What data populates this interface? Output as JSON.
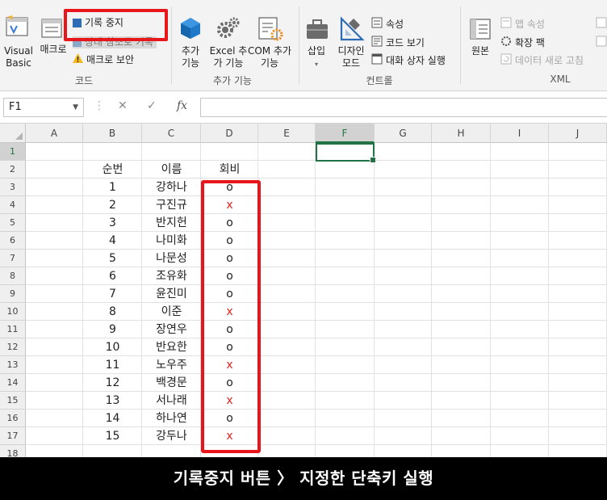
{
  "ribbon": {
    "code_group": {
      "visual_basic": "Visual Basic",
      "macro": "매크로",
      "record_stop": "기록 중지",
      "relative_ref": "상대 참조로 기록",
      "macro_security": "매크로 보안",
      "label": "코드"
    },
    "addins_group": {
      "addins": "추가 기능",
      "excel_addins": "Excel 추가 기능",
      "com_addins": "COM 추가 기능",
      "label": "추가 기능"
    },
    "controls_group": {
      "insert": "삽입",
      "design_mode": "디자인 모드",
      "properties": "속성",
      "view_code": "코드 보기",
      "run_dialog": "대화 상자 실행",
      "label": "컨트롤"
    },
    "xml_group": {
      "source": "원본",
      "map_properties": "맵 속성",
      "expansion_packs": "확장 팩",
      "refresh_data": "데이터 새로 고침",
      "label": "XML"
    }
  },
  "formula_bar": {
    "name_box": "F1",
    "formula": ""
  },
  "sheet": {
    "columns": [
      "A",
      "B",
      "C",
      "D",
      "E",
      "F",
      "G",
      "H",
      "I",
      "J"
    ],
    "selected_column": "F",
    "selected_row": "1",
    "rows": [
      "1",
      "2",
      "3",
      "4",
      "5",
      "6",
      "7",
      "8",
      "9",
      "10",
      "11",
      "12",
      "13",
      "14",
      "15",
      "16",
      "17",
      "18"
    ],
    "headers": {
      "b": "순번",
      "c": "이름",
      "d": "회비"
    },
    "records": [
      {
        "no": "1",
        "name": "강하나",
        "fee": "o"
      },
      {
        "no": "2",
        "name": "구진규",
        "fee": "x"
      },
      {
        "no": "3",
        "name": "반지헌",
        "fee": "o"
      },
      {
        "no": "4",
        "name": "나미화",
        "fee": "o"
      },
      {
        "no": "5",
        "name": "나문성",
        "fee": "o"
      },
      {
        "no": "6",
        "name": "조유화",
        "fee": "o"
      },
      {
        "no": "7",
        "name": "윤진미",
        "fee": "o"
      },
      {
        "no": "8",
        "name": "이준",
        "fee": "x"
      },
      {
        "no": "9",
        "name": "장연우",
        "fee": "o"
      },
      {
        "no": "10",
        "name": "반요한",
        "fee": "o"
      },
      {
        "no": "11",
        "name": "노우주",
        "fee": "x"
      },
      {
        "no": "12",
        "name": "백경문",
        "fee": "o"
      },
      {
        "no": "13",
        "name": "서나래",
        "fee": "x"
      },
      {
        "no": "14",
        "name": "하나연",
        "fee": "o"
      },
      {
        "no": "15",
        "name": "강두나",
        "fee": "x"
      }
    ]
  },
  "caption": "기록중지 버튼 〉 지정한 단축키 실행",
  "colors": {
    "highlight": "#e8161b",
    "excel_green": "#217346",
    "x_mark": "#e0231e",
    "stop_square": "#2e6db5"
  },
  "icons": {
    "visual_basic": "vba-editor-icon",
    "macro": "macro-list-icon",
    "stop": "stop-square-icon",
    "relative_ref": "relative-reference-icon",
    "warning": "warning-icon",
    "addins": "store-cube-icon",
    "excel_addins": "gear-icon",
    "com_addins": "com-addins-icon",
    "insert": "toolbox-icon",
    "design_mode": "design-ruler-icon",
    "properties": "properties-icon",
    "view_code": "view-code-icon",
    "run_dialog": "dialog-icon",
    "source": "xml-source-icon",
    "map_properties": "map-properties-icon",
    "expansion_packs": "expansion-pack-icon",
    "refresh_data": "refresh-icon"
  }
}
